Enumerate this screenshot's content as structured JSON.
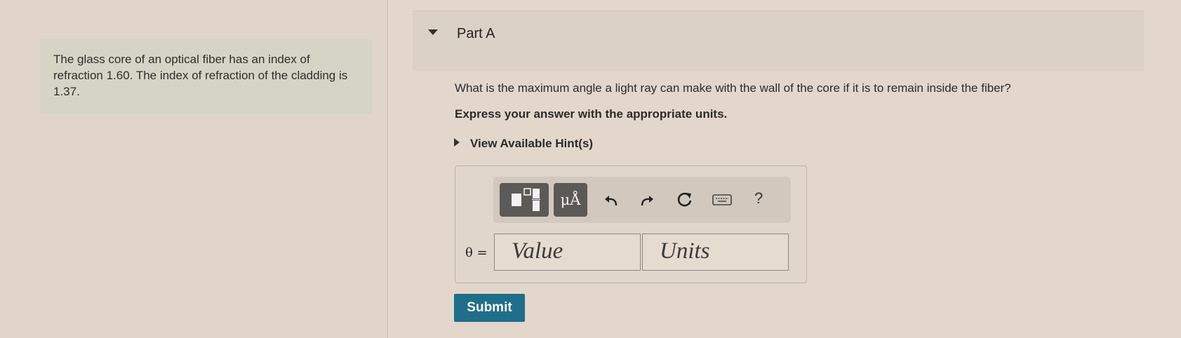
{
  "problem": {
    "text": "The glass core of an optical fiber has an index of refraction 1.60. The index of refraction of the cladding is 1.37."
  },
  "part": {
    "title": "Part A",
    "question": "What is the maximum angle a light ray can make with the wall of the core if it is to remain inside the fiber?",
    "instruction": "Express your answer with the appropriate units.",
    "hint_label": "View Available Hint(s)"
  },
  "toolbar": {
    "units_button_label": "μÅ",
    "help_label": "?",
    "icons": [
      "templates-icon",
      "units-icon",
      "undo-icon",
      "redo-icon",
      "reset-icon",
      "keyboard-icon",
      "help-icon"
    ]
  },
  "answer": {
    "variable_label": "θ =",
    "value_placeholder": "Value",
    "units_placeholder": "Units"
  },
  "submit_label": "Submit",
  "colors": {
    "background": "#e3d7cb",
    "problem_box": "#d6d4c5",
    "submit": "#1f6e8a",
    "toolbar_button": "#5c5a57"
  }
}
